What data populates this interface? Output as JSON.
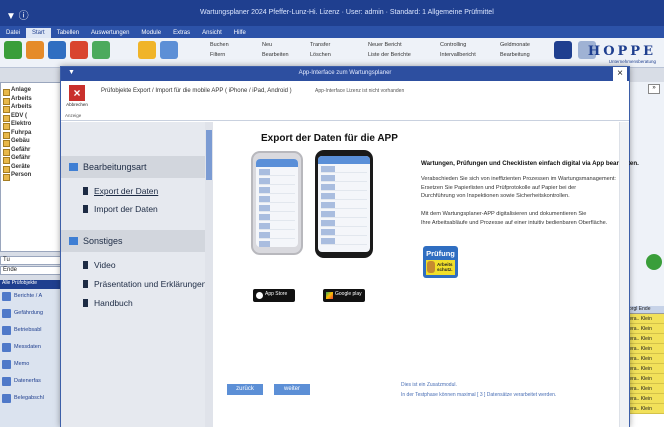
{
  "app": {
    "title": "Wartungsplaner 2024 Pfeffer-Lunz-Hi. Lizenz · User: admin · Standard: 1 Allgemeine Prüfmittel",
    "menu": [
      "Datei",
      "Start",
      "Tabellen",
      "Auswertungen",
      "Module",
      "Extras",
      "Ansicht",
      "Hilfe"
    ],
    "active_menu": "Start",
    "ribbon_labels": [
      "Buchen",
      "Neu",
      "Transfer",
      "Neuer Bericht",
      "Controlling",
      "Geldmonate",
      "Filtern",
      "Bearbeiten",
      "Löschen",
      "Liste der Berichte",
      "Intervallbericht",
      "Bearbeitung"
    ],
    "logo": "HOPPE",
    "logo_sub": "Unternehmensberatung",
    "tree": [
      "Anlage",
      "Arbeits",
      "Arbeits",
      "EDV (",
      "Elektro",
      "Fuhrpa",
      "Gebäu",
      "Gefähr",
      "Gefähr",
      "Geräte",
      "Person"
    ],
    "left_inputs": [
      "Tu",
      "Ende"
    ],
    "left_list_header": "Alle Prüfobjekte",
    "left_list": [
      "Berichte / A",
      "Gefährdung",
      "Betriebsabl",
      "Messdaten",
      "Memo",
      "Datenerfas",
      "Belegabschl"
    ],
    "right_table_header": [
      "Vorgl",
      "Ende"
    ],
    "right_table_rows": [
      "Bera.. Klein",
      "Bera.. Klein",
      "Bera.. Klein",
      "Bera.. Klein",
      "Bera.. Klein",
      "Bera.. Klein",
      "Bera.. Klein",
      "Bera.. Klein",
      "Bera.. Klein",
      "Bera.. Klein"
    ]
  },
  "modal": {
    "title": "App-Interface zum Wartungsplaner",
    "close_label": "Abbrechen",
    "ribbon_group": "Anzeige",
    "info": "Prüfobjekte Export / Import für die mobile APP ( iPhone / iPad, Android )",
    "info2": "App-Interface Lizenz ist nicht vorhanden",
    "sidebar": {
      "section1": "Bearbeitungsart",
      "items1": [
        "Export der Daten",
        "Import der Daten"
      ],
      "active_item": "Export der Daten",
      "section2": "Sonstiges",
      "items2": [
        "Video",
        "Präsentation und Erklärungen",
        "Handbuch"
      ]
    },
    "content": {
      "title": "Export der Daten für die APP",
      "headline": "Wartungen, Prüfungen und Checklisten einfach digital via App bearbeiten.",
      "para1": [
        "Verabschieden Sie sich von ineffizienten Prozessen im Wartungsmanagement:",
        "Ersetzen Sie Papierlisten und Prüfprotokolle auf Papier bei der",
        "Durchführung von Inspektionen sowie Sicherheitskontrollen."
      ],
      "para2": [
        "Mit dem Wartungsplaner-APP digitalisieren und dokumentieren Sie",
        "Ihre Arbeitsabläufe und Prozesse auf einer intuitiv bedienbaren Oberfläche."
      ],
      "badge_title": "Prüfung",
      "badge_sub1": "Arbeits",
      "badge_sub2": "schutz.",
      "appstore": "App Store",
      "googleplay": "Google play",
      "back_button": "zurück",
      "next_button": "weiter",
      "status1": "Dies ist ein Zusatzmodul.",
      "status2": "In der Testphase können maximal [ 3 ] Datensätze verarbeitet werden."
    }
  }
}
